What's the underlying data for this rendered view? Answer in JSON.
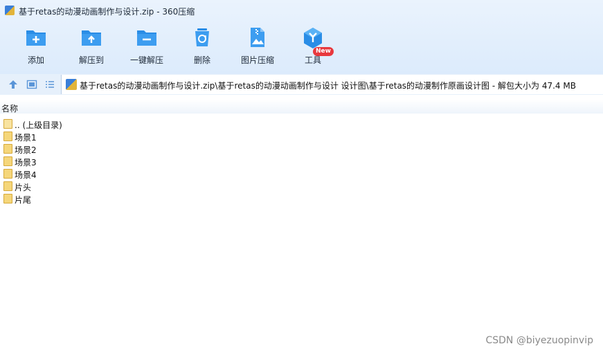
{
  "window": {
    "title": "基于retas的动漫动画制作与设计.zip - 360压缩"
  },
  "toolbar": {
    "items": [
      {
        "label": "添加",
        "icon": "add-folder-icon"
      },
      {
        "label": "解压到",
        "icon": "extract-to-icon"
      },
      {
        "label": "一键解压",
        "icon": "one-click-extract-icon"
      },
      {
        "label": "删除",
        "icon": "recycle-bin-icon"
      },
      {
        "label": "图片压缩",
        "icon": "image-compress-icon"
      },
      {
        "label": "工具",
        "icon": "tools-icon",
        "badge": "New"
      }
    ]
  },
  "navbar": {
    "icons": [
      "up-arrow-icon",
      "thumbnail-view-icon",
      "list-view-icon"
    ],
    "path": "基于retas的动漫动画制作与设计.zip\\基于retas的动漫动画制作与设计 设计图\\基于retas的动漫制作原画设计图 - 解包大小为 47.4 MB"
  },
  "columns": {
    "name": "名称"
  },
  "files": [
    {
      "name": ".. (上级目录)"
    },
    {
      "name": "场景1"
    },
    {
      "name": "场景2"
    },
    {
      "name": "场景3"
    },
    {
      "name": "场景4"
    },
    {
      "name": "片头"
    },
    {
      "name": "片尾"
    }
  ],
  "watermark": "CSDN @biyezuopinvip",
  "colors": {
    "accent": "#2a8de6",
    "badge": "#e8383d",
    "folder": "#f5d67a"
  }
}
